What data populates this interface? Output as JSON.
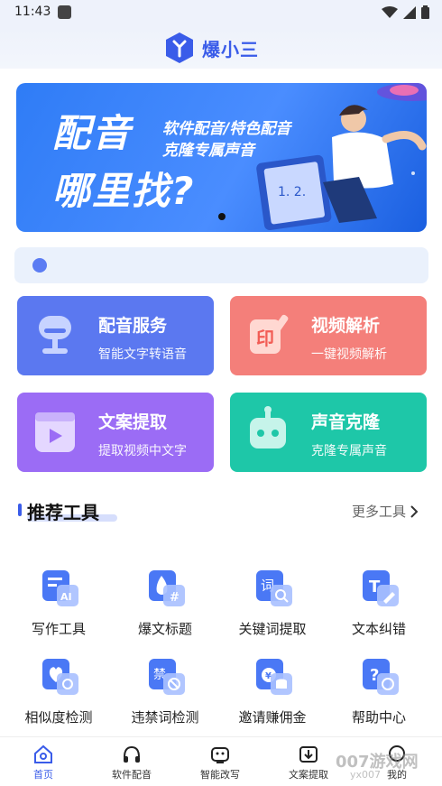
{
  "status": {
    "time": "11:43"
  },
  "app": {
    "logo_text": "爆小三"
  },
  "banner": {
    "title_line1": "配音",
    "title_line2": "哪里找?",
    "subtitle_line1": "软件配音/特色配音",
    "subtitle_line2": "克隆专属声音"
  },
  "notice": {
    "text": ""
  },
  "cards": [
    {
      "title": "配音服务",
      "subtitle": "智能文字转语音",
      "color": "#5b78f0"
    },
    {
      "title": "视频解析",
      "subtitle": "一键视频解析",
      "color": "#f47f7a"
    },
    {
      "title": "文案提取",
      "subtitle": "提取视频中文字",
      "color": "#9b6cf5"
    },
    {
      "title": "声音克隆",
      "subtitle": "克隆专属声音",
      "color": "#1ec7a8"
    }
  ],
  "section": {
    "title": "推荐工具",
    "more": "更多工具"
  },
  "tools": [
    {
      "label": "写作工具",
      "icon": "writing-icon"
    },
    {
      "label": "爆文标题",
      "icon": "hot-title-icon"
    },
    {
      "label": "关键词提取",
      "icon": "keyword-icon"
    },
    {
      "label": "文本纠错",
      "icon": "text-correct-icon"
    },
    {
      "label": "相似度检测",
      "icon": "similarity-icon"
    },
    {
      "label": "违禁词检测",
      "icon": "forbidden-word-icon"
    },
    {
      "label": "邀请赚佣金",
      "icon": "invite-icon"
    },
    {
      "label": "帮助中心",
      "icon": "help-icon"
    }
  ],
  "tabs": [
    {
      "label": "首页",
      "active": true
    },
    {
      "label": "软件配音"
    },
    {
      "label": "智能改写"
    },
    {
      "label": "文案提取"
    },
    {
      "label": "我的"
    }
  ],
  "watermark": {
    "text": "007游戏网",
    "sub": "yx007"
  },
  "colors": {
    "accent": "#3a5ce9",
    "bg": "#eef2fb"
  }
}
